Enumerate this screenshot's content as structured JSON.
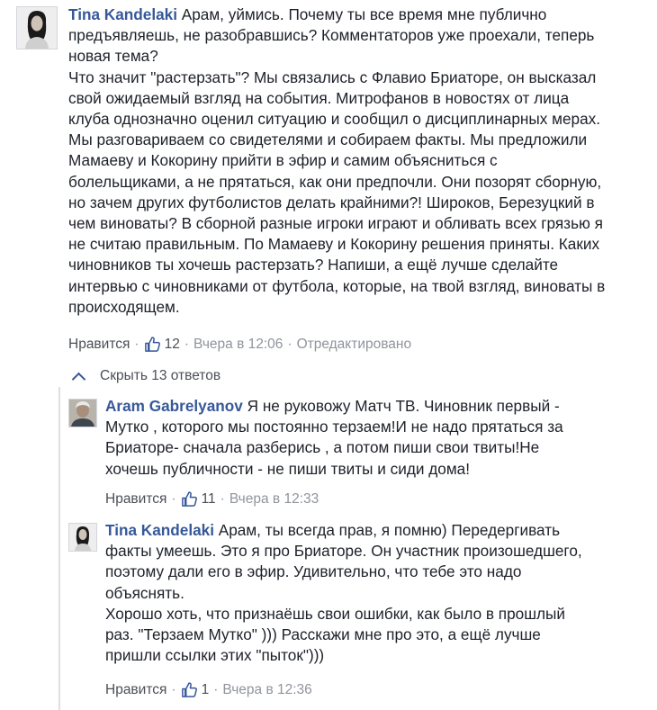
{
  "comments": [
    {
      "author": "Tina Kandelaki",
      "lines": [
        "Арам, уймись. Почему ты все время мне публично",
        "предъявляешь, не разобравшись? Комментаторов уже проехали, теперь",
        "новая тема?",
        "Что значит \"растерзать\"? Мы связались с Флавио Бриаторе, он высказал",
        "свой ожидаемый взгляд на события. Митрофанов в новостях от лица",
        "клуба однозначно оценил ситуацию и сообщил о дисциплинарных мерах.",
        "Мы разговариваем со свидетелями и собираем факты. Мы предложили",
        "Мамаеву и Кокорину прийти в эфир и самим объясниться с",
        "болельщиками, а не прятаться, как они предпочли. Они позорят сборную,",
        "но зачем других футболистов делать крайними?! Широков, Березуцкий в",
        "чем виноваты? В сборной разные игроки играют и обливать всех грязью я",
        "не считаю правильным. По Мамаеву и Кокорину решения приняты. Каких",
        "чиновников ты хочешь растерзать? Напиши, а ещё лучше сделайте",
        "интервью с чиновниками от футбола, которые, на твой взгляд, виноваты в",
        "происходящем."
      ],
      "like_label": "Нравится",
      "likes": "12",
      "timestamp": "Вчера в 12:06",
      "edited": "Отредактировано"
    }
  ],
  "hide_replies_label": "Скрыть 13 ответов",
  "replies": [
    {
      "author": "Aram Gabrelyanov",
      "lines": [
        "Я не руковожу Матч ТВ. Чиновник первый -",
        "Мутко , которого мы постоянно терзаем!И не надо прятаться за",
        "Бриаторе- сначала разберись , а потом пиши свои твиты!Не",
        "хочешь публичности - не пиши твиты и сиди дома!"
      ],
      "like_label": "Нравится",
      "likes": "11",
      "timestamp": "Вчера в 12:33"
    },
    {
      "author": "Tina Kandelaki",
      "lines": [
        "Арам, ты всегда прав, я помню)  Передергивать",
        "факты умеешь. Это я про Бриаторе. Он участник произошедшего,",
        "поэтому дали его в эфир. Удивительно, что тебе это надо",
        "объяснять.",
        "Хорошо хоть, что признаёшь свои ошибки, как было в прошлый",
        "раз. \"Терзаем Мутко\" ))) Расскажи мне про это, а ещё лучше",
        "пришли ссылки этих \"пыток\")))"
      ],
      "like_label": "Нравится",
      "likes": "1",
      "timestamp": "Вчера в 12:36"
    }
  ],
  "colors": {
    "author_link": "#365899",
    "meta": "#90949c",
    "text": "#1d2129"
  },
  "icons": {
    "like": "thumbs-up-icon",
    "collapse": "chevron-up-icon"
  }
}
